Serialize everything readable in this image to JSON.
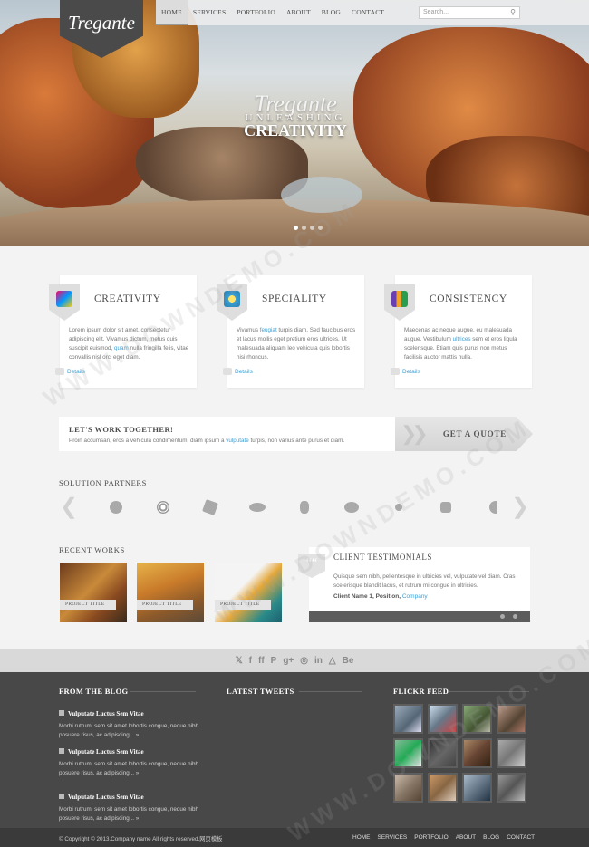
{
  "brand": {
    "logo": "Tregante"
  },
  "nav": {
    "items": [
      "HOME",
      "SERVICES",
      "PORTFOLIO",
      "ABOUT",
      "BLOG",
      "CONTACT"
    ]
  },
  "search": {
    "placeholder": "Search..."
  },
  "hero": {
    "line1": "Tregante",
    "line2": "UNLEASHING",
    "line3": "CREATIVITY"
  },
  "features": [
    {
      "title": "CREATIVITY",
      "text": "Lorem ipsum dolor sit amet, consectetur adipiscing elit. Vivamus dictum, metus quis suscipit euismod, ",
      "link": "quam",
      "text2": " nulla fringilla felis, vitae convallis nisl orci eget diam.",
      "more": "Details"
    },
    {
      "title": "SPECIALITY",
      "text": "Vivamus ",
      "link": "feugiat",
      "text2": " turpis diam. Sed faucibus eros et lacus mollis eget pretium eros ultrices. Ut malesuada aliquam leo vehicula quis lobortis nisi rhoncus.",
      "more": "Details"
    },
    {
      "title": "CONSISTENCY",
      "text": "Maecenas ac neque augue, eu malesuada augue. Vestibulum ",
      "link": "ultrices",
      "text2": " sem et eros ligula scelerisque. Etiam quis purus non metus facilisis auctor mattis nulla.",
      "more": "Details"
    }
  ],
  "cta": {
    "title": "LET'S WORK TOGETHER!",
    "text": "Proin accumsan, eros a vehicula condimentum, diam ipsum a ",
    "link": "vulputate",
    "text2": " turpis, non varius ante purus et diam.",
    "button": "GET A QUOTE"
  },
  "partners": {
    "title": "SOLUTION PARTNERS"
  },
  "works": {
    "title": "RECENT WORKS",
    "items": [
      "PROJECT TITLE",
      "PROJECT TITLE",
      "PROJECT TITLE"
    ]
  },
  "testimonials": {
    "title": "CLIENT TESTIMONIALS",
    "quote_mark": "““",
    "text": "Quisque sem nibh, pellentesque in ultricies vel, vulputate vel diam. Cras scelerisque blandit lacus, et rutrum mi congue in ultricies.",
    "name": "Client Name 1, Position, ",
    "company": "Company"
  },
  "social": [
    "𝕏",
    "f",
    "ff",
    "P",
    "g+",
    "◎",
    "in",
    "△",
    "Be"
  ],
  "footer": {
    "blog_title": "FROM THE BLOG",
    "tweets_title": "LATEST TWEETS",
    "flickr_title": "FLICKR FEED",
    "posts": [
      {
        "title": "Vulputate Luctus Sem Vitae",
        "text": "Morbi rutrum, sem sit amet lobortis congue, neque nibh posuere risus, ac adipiscing... »"
      },
      {
        "title": "Vulputate Luctus Sem Vitae",
        "text": "Morbi rutrum, sem sit amet lobortis congue, neque nibh posuere risus, ac adipiscing... »"
      },
      {
        "title": "Vulputate Luctus Sem Vitae",
        "text": "Morbi rutrum, sem sit amet lobortis congue, neque nibh posuere risus, ac adipiscing... »"
      }
    ],
    "copyright": "© Copyright © 2013.Company name All rights reserved.网页模板",
    "nav": [
      "HOME",
      "SERVICES",
      "PORTFOLIO",
      "ABOUT",
      "BLOG",
      "CONTACT"
    ]
  },
  "watermark": "WWW.DOWNDEMO.COM",
  "colors": {
    "accent": "#3aa0d6",
    "footer": "#484848",
    "tab": "#4a4a4a"
  }
}
